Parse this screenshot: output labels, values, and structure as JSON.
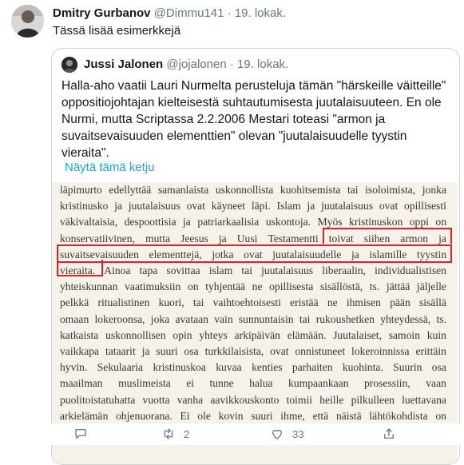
{
  "tweet": {
    "author_name": "Dmitry Gurbanov",
    "author_handle": "@Dimmu141",
    "date": "19. lokak.",
    "text": "Tässä lisää esimerkkejä"
  },
  "quoted_tweet": {
    "author_name": "Jussi Jalonen",
    "author_handle": "@jojalonen",
    "date": "19. lokak.",
    "text": "Halla-aho vaatii Lauri Nurmelta perusteluja tämän \"härskeille väitteille\" oppositiojohtajan kielteisestä suhtautumisesta juutalaisuuteen. En ole Nurmi, mutta Scriptassa 2.2.2006 Mestari toteasi \"armon ja suvaitsevaisuuden elementtien\" olevan \"juutalaisuudelle tyystin vieraita\".",
    "show_thread_label": "Näytä tämä ketju"
  },
  "document_lines": [
    "läpimurto edellyttää samanlaista uskonnollista kuohitsemista tai isoloimista, jonka",
    "kristinusko ja juutalaisuus ovat käyneet läpi. Islam ja juutalaisuus ovat opillisesti",
    "väkivaltaisia, despoottisia ja patriarkaalisia uskontoja. Myös kristinuskon oppi on",
    "konservatiivinen, mutta Jeesus ja Uusi Testamentti toivat siihen armon ja",
    "suvaitsevaisuuden elementtejä, jotka ovat juutalaisuudelle ja islamille tyystin",
    "vieraita. Ainoa tapa sovittaa islam tai juutalaisuus liberaalin, individualistisen",
    "yhteiskunnan vaatimuksiin on tyhjentää ne opillisesta sisällöstä, ts. jättää jäljelle",
    "pelkkä ritualistinen kuori, tai vaihtoehtoisesti eristää ne ihmisen pään sisällä",
    "omaan lokeroonsa, joka avataan vain sunnuntaisin tai rukoushetken yhteydessä, ts.",
    "katkaista uskonnollisen opin yhteys arkipäivän elämään. Juutalaiset, samoin kuin",
    "vaikkapa tataarit ja suuri osa turkkilaisista, ovat onnistuneet lokeroinnissa erittäin",
    "hyvin. Sekulaaria kristinuskoa kuvaa kenties parhaiten kuohinta. Suurin osa",
    "maailman muslimeista ei tunne halua kumpaankaan prosessiin, vaan",
    "puolitoistatuhatta vuotta vanha aavikkouskonto toimii heille pilkulleen luettavana",
    "arkielämän ohjenuorana. Ei ole kovin suuri ihme, että näistä lähtökohdista on"
  ],
  "actions": {
    "retweet_count": "2",
    "like_count": "33"
  },
  "colors": {
    "accent": "#1da1f2",
    "highlight": "#e0202a",
    "paper": "#f6f2ea"
  }
}
